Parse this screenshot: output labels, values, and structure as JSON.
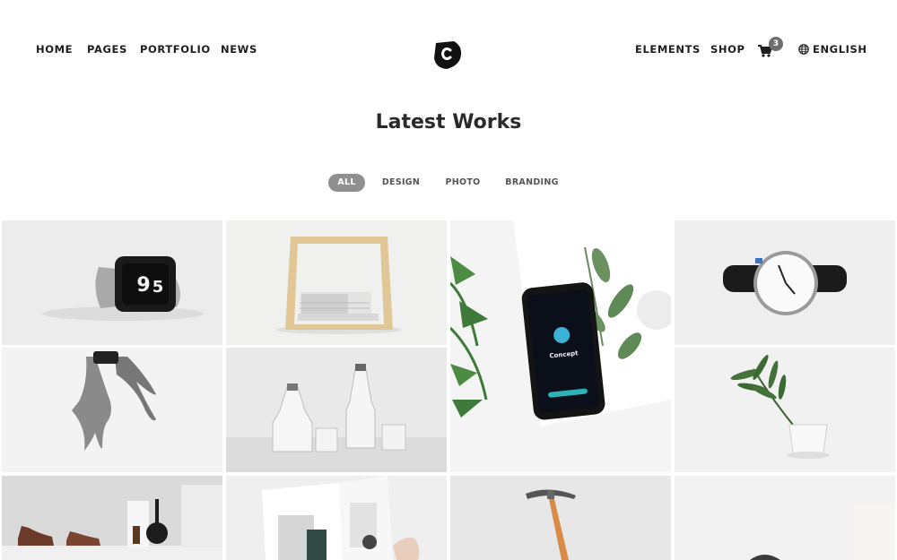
{
  "nav": {
    "left": [
      "HOME",
      "PAGES",
      "PORTFOLIO",
      "NEWS"
    ],
    "right": [
      "ELEMENTS",
      "SHOP"
    ],
    "cart_count": "3",
    "language": "ENGLISH"
  },
  "icons": {
    "logo": "brand-logo",
    "cart": "cart-icon",
    "language": "globe-icon"
  },
  "section": {
    "title": "Latest Works"
  },
  "filters": {
    "items": [
      "ALL",
      "DESIGN",
      "PHOTO",
      "BRANDING"
    ],
    "active": "ALL"
  },
  "phone_screen": {
    "label": "Concept"
  },
  "colors": {
    "filter_active_bg": "#8f8f8f",
    "cart_badge": "#6e6e6e",
    "text": "#1e1e1e"
  }
}
